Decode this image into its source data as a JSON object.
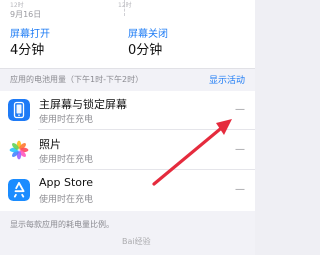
{
  "top": {
    "chart_time_left": "12时",
    "chart_time_mid": "12时",
    "date": "9月16日"
  },
  "stats": {
    "screen_on": {
      "label": "屏幕打开",
      "value": "4分钟"
    },
    "screen_off": {
      "label": "屏幕关闭",
      "value": "0分钟"
    }
  },
  "section": {
    "title": "应用的电池用量（下午1时-下午2时）",
    "action": "显示活动"
  },
  "apps": [
    {
      "name": "主屏幕与锁定屏幕",
      "subtitle": "使用时在充电",
      "value": "—",
      "icon": "phone-icon"
    },
    {
      "name": "照片",
      "subtitle": "使用时在充电",
      "value": "—",
      "icon": "photos-icon"
    },
    {
      "name": "App Store",
      "subtitle": "使用时在充电",
      "value": "—",
      "icon": "app-store-icon"
    }
  ],
  "footer": {
    "text": "显示每款应用的耗电量比例。"
  },
  "watermark": {
    "text": "Bai经验"
  },
  "colors": {
    "accent": "#1e7cf5",
    "annotation_arrow": "#e52b3d",
    "background": "#f2f2f7",
    "surface": "#ffffff"
  }
}
